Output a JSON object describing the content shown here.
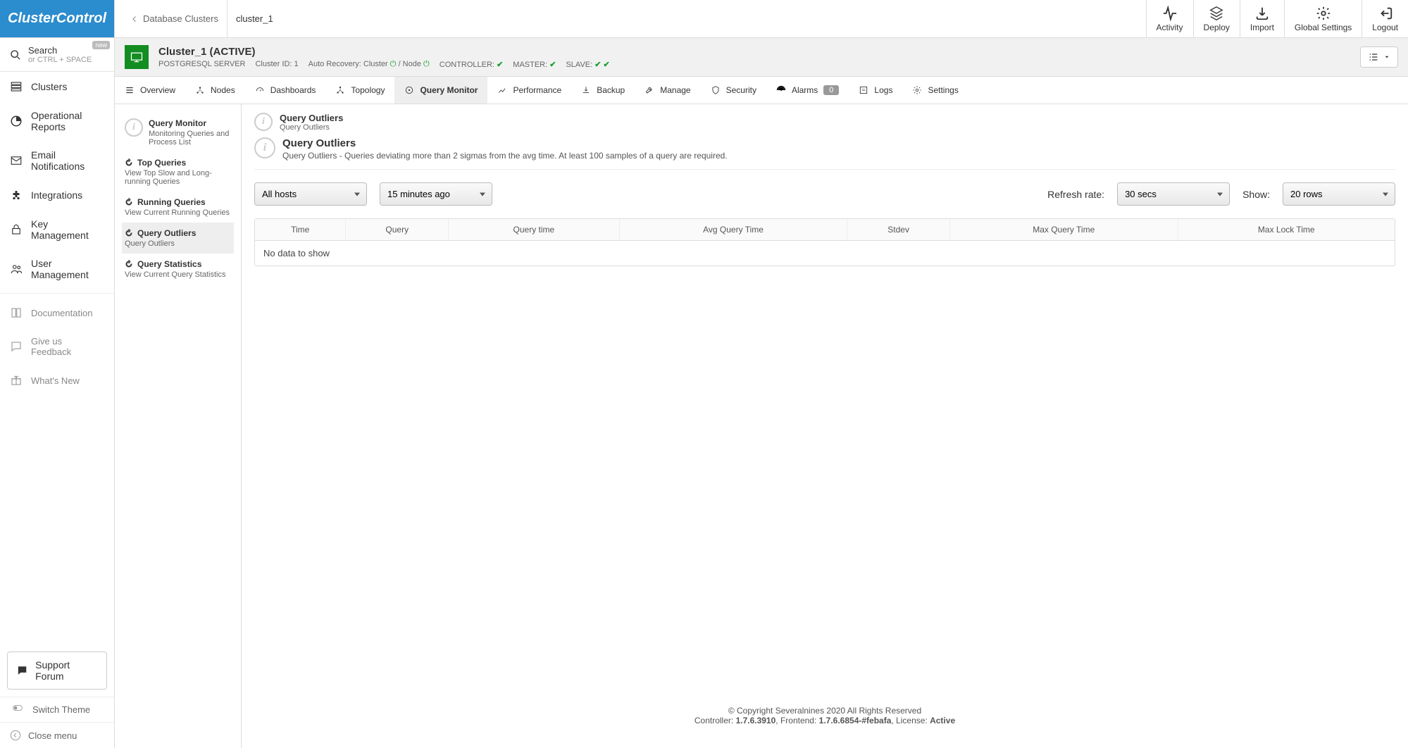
{
  "logo": "ClusterControl",
  "breadcrumb": {
    "root": "Database Clusters",
    "current": "cluster_1"
  },
  "topbar": {
    "activity": "Activity",
    "deploy": "Deploy",
    "import": "Import",
    "globalSettings": "Global Settings",
    "logout": "Logout"
  },
  "search": {
    "label": "Search",
    "hint": "or CTRL + SPACE",
    "newBadge": "new"
  },
  "sidebar": {
    "clusters": "Clusters",
    "reports": "Operational Reports",
    "email": "Email Notifications",
    "integrations": "Integrations",
    "keymgmt": "Key Management",
    "usermgmt": "User Management",
    "docs": "Documentation",
    "feedback": "Give us Feedback",
    "whatsnew": "What's New",
    "forum": "Support Forum",
    "theme": "Switch Theme",
    "close": "Close menu"
  },
  "cluster": {
    "title": "Cluster_1 (ACTIVE)",
    "type": "POSTGRESQL SERVER",
    "idLabel": "Cluster ID: 1",
    "autoRecLabel": "Auto Recovery: Cluster",
    "nodeLabel": "/ Node",
    "controller": "CONTROLLER:",
    "master": "MASTER:",
    "slave": "SLAVE:"
  },
  "tabs": {
    "overview": "Overview",
    "nodes": "Nodes",
    "dashboards": "Dashboards",
    "topology": "Topology",
    "querymon": "Query Monitor",
    "performance": "Performance",
    "backup": "Backup",
    "manage": "Manage",
    "security": "Security",
    "alarms": "Alarms",
    "alarmsCount": "0",
    "logs": "Logs",
    "settings": "Settings"
  },
  "subnav": {
    "qm": {
      "t": "Query Monitor",
      "d": "Monitoring Queries and Process List"
    },
    "top": {
      "t": "Top Queries",
      "d": "View Top Slow and Long-running Queries"
    },
    "running": {
      "t": "Running Queries",
      "d": "View Current Running Queries"
    },
    "outliers": {
      "t": "Query Outliers",
      "d": "Query Outliers"
    },
    "stats": {
      "t": "Query Statistics",
      "d": "View Current Query Statistics"
    }
  },
  "panel": {
    "head": {
      "t": "Query Outliers",
      "d": "Query Outliers"
    },
    "sub": {
      "t": "Query Outliers",
      "d": "Query Outliers - Queries deviating more than 2 sigmas from the avg time. At least 100 samples of a query are required."
    }
  },
  "controls": {
    "hosts": "All hosts",
    "range": "15 minutes ago",
    "refreshLabel": "Refresh rate:",
    "refresh": "30 secs",
    "showLabel": "Show:",
    "show": "20 rows"
  },
  "table": {
    "cols": [
      "Time",
      "Query",
      "Query time",
      "Avg Query Time",
      "Stdev",
      "Max Query Time",
      "Max Lock Time"
    ],
    "empty": "No data to show"
  },
  "footer": {
    "copyright": "© Copyright Severalnines 2020 All Rights Reserved",
    "line2a": "Controller: ",
    "ctrlVer": "1.7.6.3910",
    "line2b": ", Frontend: ",
    "feVer": "1.7.6.6854-#febafa",
    "line2c": ", License: ",
    "license": "Active"
  }
}
